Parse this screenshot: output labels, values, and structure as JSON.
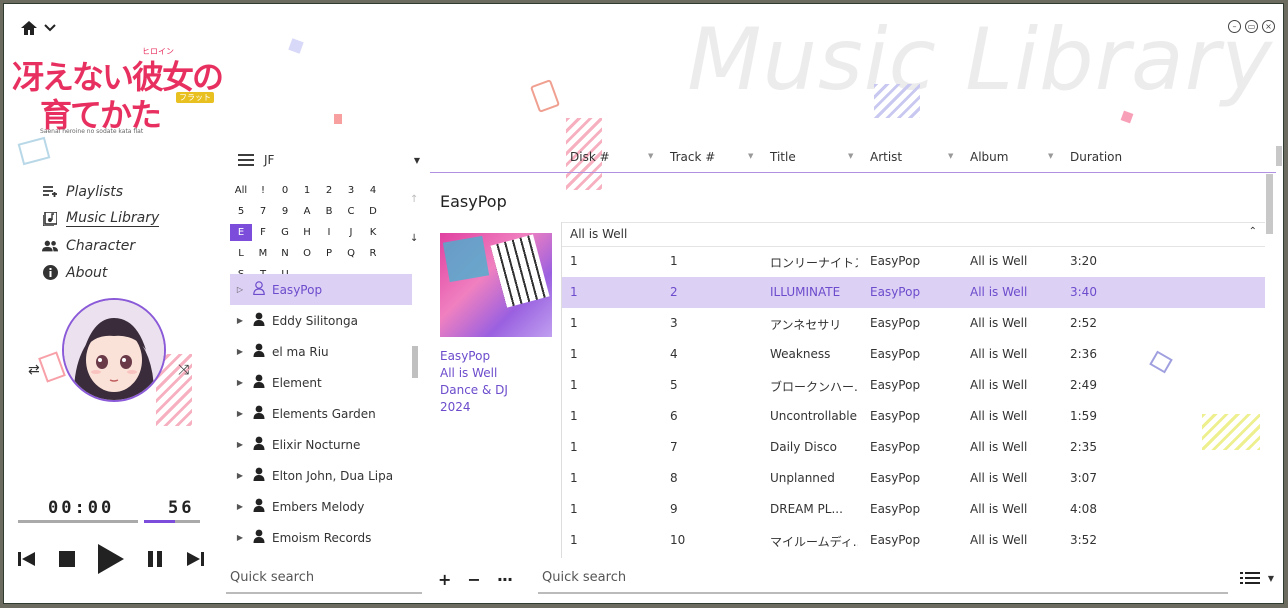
{
  "window": {
    "bg_title": "Music Library",
    "controls": [
      "minimize-icon",
      "restore-icon",
      "close-icon"
    ]
  },
  "logo": {
    "line1": "冴えない彼女の",
    "line2": "育てかた",
    "romaji": "Saenai heroine no sodate kata flat",
    "top_tag": "ヒロイン",
    "badge": "フラット"
  },
  "nav": {
    "items": [
      {
        "label": "Playlists",
        "icon": "playlist-icon"
      },
      {
        "label": "Music Library",
        "icon": "library-icon"
      },
      {
        "label": "Character",
        "icon": "people-icon"
      },
      {
        "label": "About",
        "icon": "info-icon"
      }
    ]
  },
  "player": {
    "time": "00:00",
    "volume": "56",
    "progress": 0.0,
    "volume_level": 0.56
  },
  "artist_panel": {
    "group": "JF",
    "alphabet": [
      "All",
      "!",
      "0",
      "1",
      "2",
      "3",
      "4",
      "5",
      "7",
      "9",
      "A",
      "B",
      "C",
      "D",
      "E",
      "F",
      "G",
      "H",
      "I",
      "J",
      "K",
      "L",
      "M",
      "N",
      "O",
      "P",
      "Q",
      "R",
      "S",
      "T",
      "U"
    ],
    "selected_letter": "E",
    "artists": [
      "EasyPop",
      "Eddy Silitonga",
      "el ma Riu",
      "Element",
      "Elements Garden",
      "Elixir Nocturne",
      "Elton John, Dua Lipa",
      "Embers Melody",
      "Emoism Records"
    ],
    "selected_artist": "EasyPop",
    "search_placeholder": "Quick search"
  },
  "track_table": {
    "columns": [
      "Disk #",
      "Track #",
      "Title",
      "Artist",
      "Album",
      "Duration"
    ],
    "album_header": "EasyPop",
    "album_info": {
      "artist": "EasyPop",
      "album": "All is Well",
      "genre": "Dance & DJ",
      "year": "2024"
    },
    "disc_group": "All is Well",
    "rows": [
      {
        "disk": "1",
        "track": "1",
        "title": "ロンリーナイトス...",
        "artist": "EasyPop",
        "album": "All is Well",
        "duration": "3:20"
      },
      {
        "disk": "1",
        "track": "2",
        "title": "ILLUMINATE",
        "artist": "EasyPop",
        "album": "All is Well",
        "duration": "3:40"
      },
      {
        "disk": "1",
        "track": "3",
        "title": "アンネセサリ",
        "artist": "EasyPop",
        "album": "All is Well",
        "duration": "2:52"
      },
      {
        "disk": "1",
        "track": "4",
        "title": "Weakness",
        "artist": "EasyPop",
        "album": "All is Well",
        "duration": "2:36"
      },
      {
        "disk": "1",
        "track": "5",
        "title": "ブロークンハー...",
        "artist": "EasyPop",
        "album": "All is Well",
        "duration": "2:49"
      },
      {
        "disk": "1",
        "track": "6",
        "title": "Uncontrollable",
        "artist": "EasyPop",
        "album": "All is Well",
        "duration": "1:59"
      },
      {
        "disk": "1",
        "track": "7",
        "title": "Daily Disco",
        "artist": "EasyPop",
        "album": "All is Well",
        "duration": "2:35"
      },
      {
        "disk": "1",
        "track": "8",
        "title": "Unplanned",
        "artist": "EasyPop",
        "album": "All is Well",
        "duration": "3:07"
      },
      {
        "disk": "1",
        "track": "9",
        "title": "DREAM PL...",
        "artist": "EasyPop",
        "album": "All is Well",
        "duration": "4:08"
      },
      {
        "disk": "1",
        "track": "10",
        "title": "マイルームディ...",
        "artist": "EasyPop",
        "album": "All is Well",
        "duration": "3:52"
      }
    ],
    "selected_row": 1,
    "search_placeholder": "Quick search"
  },
  "colors": {
    "accent": "#7c4ddb",
    "selection": "#ddd0f5",
    "selection_text": "#6c4ccc",
    "logo": "#e83060"
  }
}
